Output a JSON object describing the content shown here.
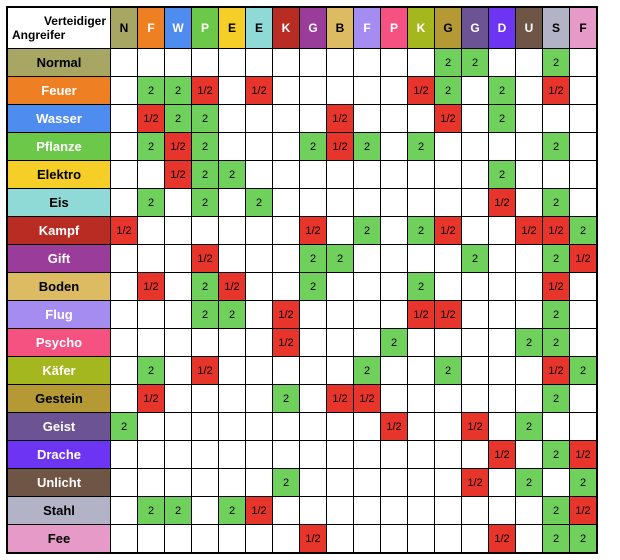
{
  "corner": {
    "top": "Verteidiger",
    "bottom": "Angreifer"
  },
  "types": [
    {
      "name": "Normal",
      "letter": "N",
      "class": "t-normal"
    },
    {
      "name": "Feuer",
      "letter": "F",
      "class": "t-feuer"
    },
    {
      "name": "Wasser",
      "letter": "W",
      "class": "t-wasser"
    },
    {
      "name": "Pflanze",
      "letter": "P",
      "class": "t-pflanze"
    },
    {
      "name": "Elektro",
      "letter": "E",
      "class": "t-elektro"
    },
    {
      "name": "Eis",
      "letter": "E",
      "class": "t-eis"
    },
    {
      "name": "Kampf",
      "letter": "K",
      "class": "t-kampf"
    },
    {
      "name": "Gift",
      "letter": "G",
      "class": "t-gift"
    },
    {
      "name": "Boden",
      "letter": "B",
      "class": "t-boden"
    },
    {
      "name": "Flug",
      "letter": "F",
      "class": "t-flug"
    },
    {
      "name": "Psycho",
      "letter": "P",
      "class": "t-psycho"
    },
    {
      "name": "Käfer",
      "letter": "K",
      "class": "t-kaefer"
    },
    {
      "name": "Gestein",
      "letter": "G",
      "class": "t-gestein"
    },
    {
      "name": "Geist",
      "letter": "G",
      "class": "t-geist"
    },
    {
      "name": "Drache",
      "letter": "D",
      "class": "t-drache"
    },
    {
      "name": "Unlicht",
      "letter": "U",
      "class": "t-unlicht"
    },
    {
      "name": "Stahl",
      "letter": "S",
      "class": "t-stahl"
    },
    {
      "name": "Fee",
      "letter": "F",
      "class": "t-fee"
    }
  ],
  "labels": {
    "two": "2",
    "half": "1/2"
  },
  "chart_data": {
    "type": "heatmap",
    "title": "",
    "xlabel": "Verteidiger",
    "ylabel": "Angreifer",
    "categories_x": [
      "Normal",
      "Feuer",
      "Wasser",
      "Pflanze",
      "Elektro",
      "Eis",
      "Kampf",
      "Gift",
      "Boden",
      "Flug",
      "Psycho",
      "Käfer",
      "Gestein",
      "Geist",
      "Drache",
      "Unlicht",
      "Stahl",
      "Fee"
    ],
    "categories_y": [
      "Normal",
      "Feuer",
      "Wasser",
      "Pflanze",
      "Elektro",
      "Eis",
      "Kampf",
      "Gift",
      "Boden",
      "Flug",
      "Psycho",
      "Käfer",
      "Gestein",
      "Geist",
      "Drache",
      "Unlicht",
      "Stahl",
      "Fee"
    ],
    "values": [
      [
        "",
        "",
        "",
        "",
        "",
        "",
        "",
        "",
        "",
        "",
        "",
        "",
        "2",
        "2",
        "",
        "",
        "2",
        ""
      ],
      [
        "",
        "2",
        "2",
        "1/2",
        "",
        "1/2",
        "",
        "",
        "",
        "",
        "",
        "1/2",
        "2",
        "",
        "2",
        "",
        "1/2",
        ""
      ],
      [
        "",
        "1/2",
        "2",
        "2",
        "",
        "",
        "",
        "",
        "1/2",
        "",
        "",
        "",
        "1/2",
        "",
        "2",
        "",
        "",
        ""
      ],
      [
        "",
        "2",
        "1/2",
        "2",
        "",
        "",
        "",
        "2",
        "1/2",
        "2",
        "",
        "2",
        "",
        "",
        "",
        "",
        "2",
        ""
      ],
      [
        "",
        "",
        "1/2",
        "2",
        "2",
        "",
        "",
        "",
        "",
        "",
        "",
        "",
        "",
        "",
        "2",
        "",
        "",
        ""
      ],
      [
        "",
        "2",
        "",
        "2",
        "",
        "2",
        "",
        "",
        "",
        "",
        "",
        "",
        "",
        "",
        "1/2",
        "",
        "2",
        ""
      ],
      [
        "1/2",
        "",
        "",
        "",
        "",
        "",
        "",
        "1/2",
        "",
        "2",
        "",
        "2",
        "1/2",
        "",
        "",
        "1/2",
        "1/2",
        "2"
      ],
      [
        "",
        "",
        "",
        "1/2",
        "",
        "",
        "",
        "2",
        "2",
        "",
        "",
        "",
        "",
        "2",
        "",
        "",
        "2",
        "1/2"
      ],
      [
        "",
        "1/2",
        "",
        "2",
        "1/2",
        "",
        "",
        "2",
        "",
        "",
        "",
        "2",
        "",
        "",
        "",
        "",
        "1/2",
        ""
      ],
      [
        "",
        "",
        "",
        "2",
        "2",
        "",
        "1/2",
        "",
        "",
        "",
        "",
        "1/2",
        "1/2",
        "",
        "",
        "",
        "2",
        ""
      ],
      [
        "",
        "",
        "",
        "",
        "",
        "",
        "1/2",
        "",
        "",
        "",
        "2",
        "",
        "",
        "",
        "",
        "2",
        "2",
        ""
      ],
      [
        "",
        "2",
        "",
        "1/2",
        "",
        "",
        "",
        "",
        "",
        "2",
        "",
        "",
        "2",
        "",
        "",
        "",
        "1/2",
        "2"
      ],
      [
        "",
        "1/2",
        "",
        "",
        "",
        "",
        "2",
        "",
        "1/2",
        "1/2",
        "",
        "",
        "",
        "",
        "",
        "",
        "2",
        ""
      ],
      [
        "2",
        "",
        "",
        "",
        "",
        "",
        "",
        "",
        "",
        "",
        "1/2",
        "",
        "",
        "1/2",
        "",
        "2",
        "",
        ""
      ],
      [
        "",
        "",
        "",
        "",
        "",
        "",
        "",
        "",
        "",
        "",
        "",
        "",
        "",
        "",
        "1/2",
        "",
        "2",
        "1/2"
      ],
      [
        "",
        "",
        "",
        "",
        "",
        "",
        "2",
        "",
        "",
        "",
        "",
        "",
        "",
        "1/2",
        "",
        "2",
        "",
        "2"
      ],
      [
        "",
        "2",
        "2",
        "",
        "2",
        "1/2",
        "",
        "",
        "",
        "",
        "",
        "",
        "",
        "",
        "",
        "",
        "2",
        "1/2"
      ],
      [
        "",
        "",
        "",
        "",
        "",
        "",
        "",
        "1/2",
        "",
        "",
        "",
        "",
        "",
        "",
        "1/2",
        "",
        "2",
        "2"
      ]
    ]
  }
}
